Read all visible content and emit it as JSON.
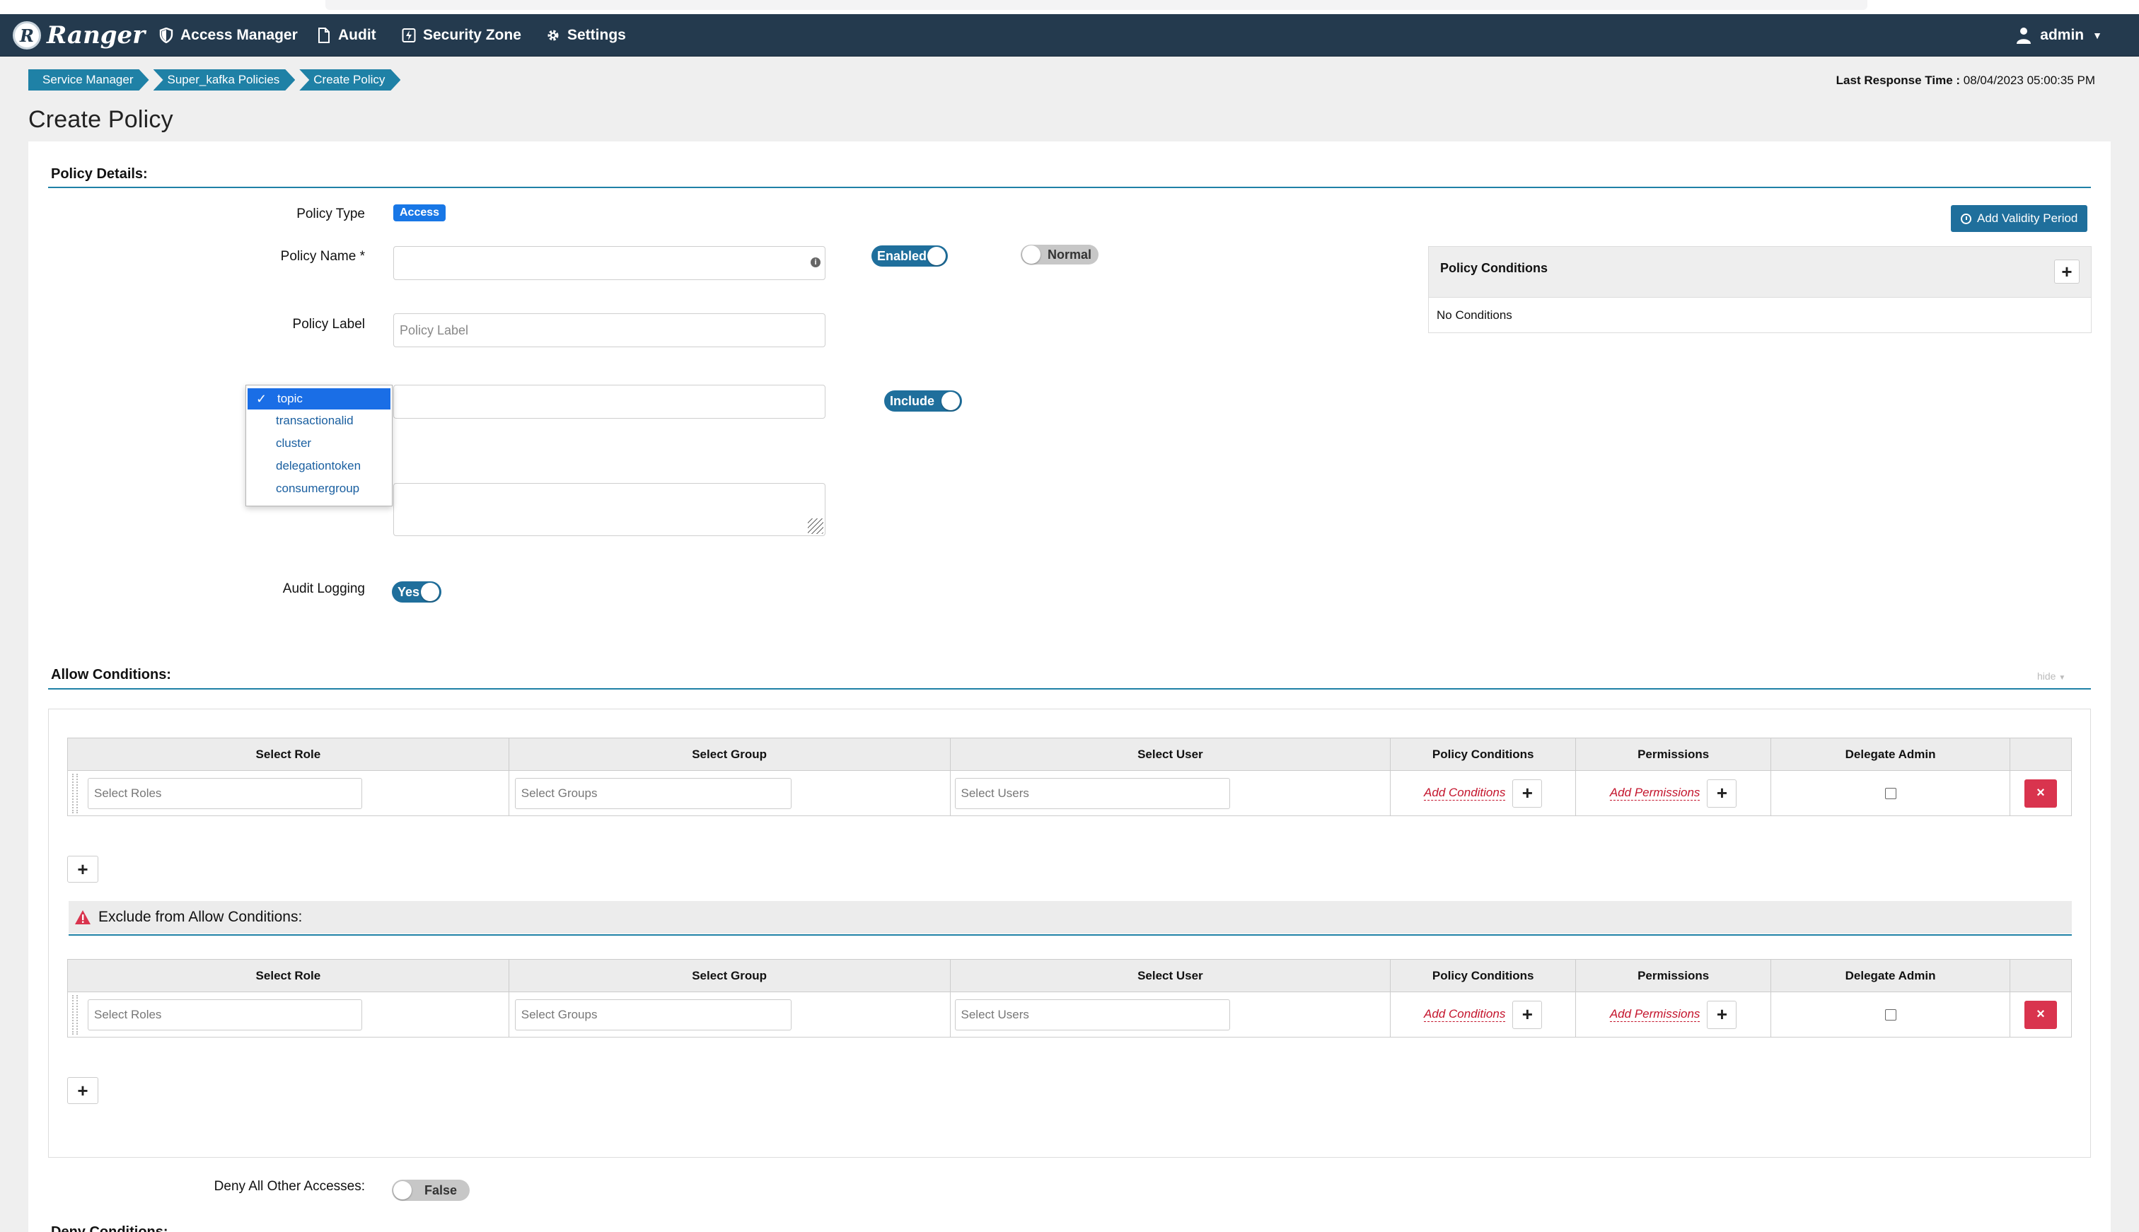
{
  "navbar": {
    "brand": "Ranger",
    "logo_letter": "R",
    "items": [
      "Access Manager",
      "Audit",
      "Security Zone",
      "Settings"
    ],
    "user": "admin"
  },
  "breadcrumb": [
    "Service Manager",
    "Super_kafka Policies",
    "Create Policy"
  ],
  "last_response": {
    "label": "Last Response Time :",
    "value": "08/04/2023 05:00:35 PM"
  },
  "page_title": "Create Policy",
  "policy_details": {
    "section_title": "Policy Details:",
    "policy_type_label": "Policy Type",
    "policy_type_value": "Access",
    "policy_name_label": "Policy Name *",
    "policy_name_value": "",
    "enabled_toggle": "Enabled",
    "normal_toggle": "Normal",
    "policy_label_label": "Policy Label",
    "policy_label_placeholder": "Policy Label",
    "include_toggle": "Include",
    "audit_logging_label": "Audit Logging",
    "audit_logging_value": "Yes",
    "add_validity_button": "Add Validity Period",
    "policy_conditions_title": "Policy Conditions",
    "no_conditions": "No Conditions"
  },
  "resource_dropdown": {
    "selected": "topic",
    "options": [
      "topic",
      "transactionalid",
      "cluster",
      "delegationtoken",
      "consumergroup"
    ]
  },
  "allow_conditions": {
    "section_title": "Allow Conditions:",
    "hide_link": "hide",
    "columns": [
      "Select Role",
      "Select Group",
      "Select User",
      "Policy Conditions",
      "Permissions",
      "Delegate Admin"
    ],
    "role_placeholder": "Select Roles",
    "group_placeholder": "Select Groups",
    "user_placeholder": "Select Users",
    "add_conditions": "Add Conditions",
    "add_permissions": "Add Permissions"
  },
  "exclude_allow": {
    "title": "Exclude from Allow Conditions:",
    "columns": [
      "Select Role",
      "Select Group",
      "Select User",
      "Policy Conditions",
      "Permissions",
      "Delegate Admin"
    ],
    "role_placeholder": "Select Roles",
    "group_placeholder": "Select Groups",
    "user_placeholder": "Select Users",
    "add_conditions": "Add Conditions",
    "add_permissions": "Add Permissions"
  },
  "deny_all": {
    "label": "Deny All Other Accesses:",
    "value": "False"
  },
  "deny_conditions": {
    "section_title": "Deny Conditions:"
  },
  "colors": {
    "navbar": "#243a4e",
    "accent": "#1f81a6",
    "toggle": "#1f6f9c",
    "delete": "#d9344e",
    "link_red": "#c4142c"
  }
}
